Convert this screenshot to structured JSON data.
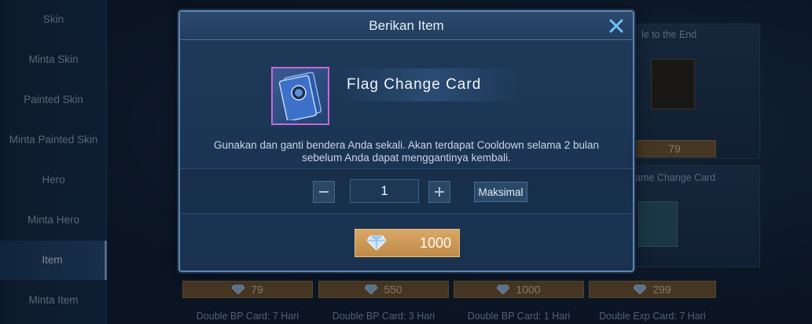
{
  "sidebar": {
    "items": [
      {
        "label": "Skin"
      },
      {
        "label": "Minta Skin"
      },
      {
        "label": "Painted Skin"
      },
      {
        "label": "Minta Painted Skin"
      },
      {
        "label": "Hero"
      },
      {
        "label": "Minta Hero"
      },
      {
        "label": "Item",
        "active": true
      },
      {
        "label": "Minta Item"
      }
    ]
  },
  "background_shop": {
    "right_card_top_title": "le to the End",
    "right_card_mid_title": "ame Change Card",
    "right_card_top_price": "79",
    "prices": [
      "79",
      "550",
      "1000",
      "299"
    ],
    "names": [
      "Double BP Card: 7 Hari",
      "Double BP Card: 3 Hari",
      "Double BP Card: 1 Hari",
      "Double Exp Card: 7 Hari"
    ]
  },
  "dialog": {
    "title": "Berikan Item",
    "item_name": "Flag Change Card",
    "description": "Gunakan dan ganti bendera Anda sekali. Akan terdapat Cooldown selama 2 bulan sebelum Anda dapat menggantinya kembali.",
    "quantity": "1",
    "max_label": "Maksimal",
    "price": "1000"
  },
  "icons": {
    "close": "close-icon",
    "minus": "minus-icon",
    "plus": "plus-icon",
    "diamond": "diamond-icon",
    "flag_card": "flag-change-card-icon"
  },
  "colors": {
    "accent_gold": "#c99a58",
    "frame_blue": "#5d86b3",
    "close_blue": "#6fc1f5",
    "rarity_purple": "#c46ad8"
  }
}
